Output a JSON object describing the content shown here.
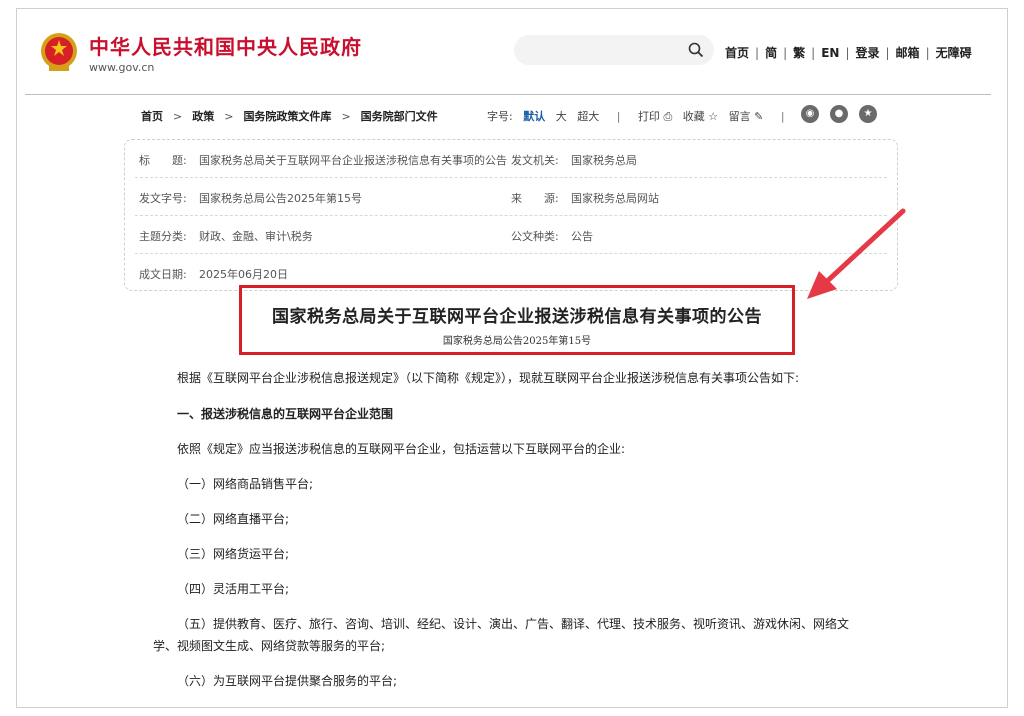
{
  "header": {
    "site_title": "中华人民共和国中央人民政府",
    "site_url": "www.gov.cn",
    "search_placeholder": "",
    "nav": [
      "首页",
      "简",
      "繁",
      "EN",
      "登录",
      "邮箱",
      "无障碍"
    ]
  },
  "breadcrumb": {
    "items": [
      "首页",
      "政策",
      "国务院政策文件库",
      "国务院部门文件"
    ]
  },
  "tools": {
    "font_label": "字号:",
    "font_default": "默认",
    "font_large": "大",
    "font_xlarge": "超大",
    "print": "打印",
    "favorite": "收藏",
    "comment": "留言"
  },
  "meta": {
    "title_label": "标　　题:",
    "title_value": "国家税务总局关于互联网平台企业报送涉税信息有关事项的公告",
    "issuer_label": "发文机关:",
    "issuer_value": "国家税务总局",
    "docno_label": "发文字号:",
    "docno_value": "国家税务总局公告2025年第15号",
    "source_label": "来　　源:",
    "source_value": "国家税务总局网站",
    "topic_label": "主题分类:",
    "topic_value": "财政、金融、审计\\税务",
    "type_label": "公文种类:",
    "type_value": "公告",
    "date_label": "成文日期:",
    "date_value": "2025年06月20日"
  },
  "article": {
    "title": "国家税务总局关于互联网平台企业报送涉税信息有关事项的公告",
    "subtitle": "国家税务总局公告2025年第15号",
    "intro": "根据《互联网平台企业涉税信息报送规定》（以下简称《规定》），现就互联网平台企业报送涉税信息有关事项公告如下:",
    "section1": "一、报送涉税信息的互联网平台企业范围",
    "section1_lead": "依照《规定》应当报送涉税信息的互联网平台企业，包括运营以下互联网平台的企业:",
    "item1": "（一）网络商品销售平台;",
    "item2": "（二）网络直播平台;",
    "item3": "（三）网络货运平台;",
    "item4": "（四）灵活用工平台;",
    "item5_line1": "（五）提供教育、医疗、旅行、咨询、培训、经纪、设计、演出、广告、翻译、代理、技术服务、视听资讯、游戏休闲、网络文",
    "item5_line2": "学、视频图文生成、网络贷款等服务的平台;",
    "item6": "（六）为互联网平台提供聚合服务的平台;"
  },
  "colors": {
    "brand_red": "#c8102e",
    "highlight_red": "#d71f26",
    "link_blue": "#1a5fa8"
  }
}
